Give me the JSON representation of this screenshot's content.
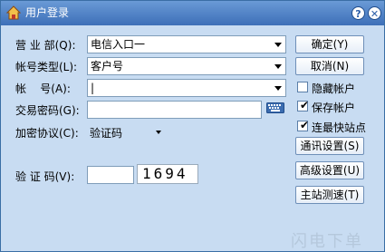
{
  "window": {
    "title": "用户登录",
    "help_glyph": "?",
    "close_glyph": "✕"
  },
  "form": {
    "branch_label": "营 业 部(Q):",
    "branch_value": "电信入口一",
    "account_type_label": "帐号类型(L):",
    "account_type_value": "客户号",
    "account_label": "帐    号(A):",
    "account_value": "|",
    "password_label": "交易密码(G):",
    "encryption_label": "加密协议(C):",
    "encryption_value": "验证码",
    "captcha_label": "验 证 码(V):",
    "captcha_code": "1694"
  },
  "buttons": {
    "ok": "确定(Y)",
    "cancel": "取消(N)",
    "comm_settings": "通讯设置(S)",
    "advanced_settings": "高级设置(U)",
    "server_test": "主站测速(T)"
  },
  "options": {
    "hide_account": {
      "label": "隐藏帐户",
      "checked": false
    },
    "save_account": {
      "label": "保存帐户",
      "checked": true
    },
    "fastest_site": {
      "label": "连最快站点",
      "checked": true
    }
  },
  "watermark": "闪电下单",
  "colors": {
    "title_bar": "#3d6fb8",
    "panel": "#c8dcf2",
    "button_border": "#6e8fb8"
  }
}
